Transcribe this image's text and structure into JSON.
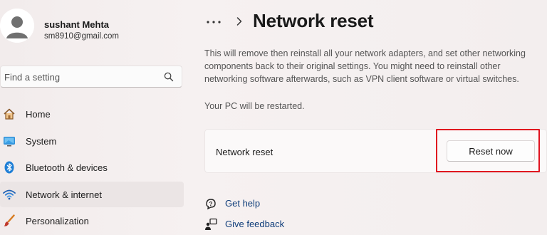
{
  "user": {
    "name": "sushant Mehta",
    "email": "sm8910@gmail.com"
  },
  "search": {
    "placeholder": "Find a setting"
  },
  "nav": {
    "items": [
      {
        "label": "Home",
        "icon": "home-icon"
      },
      {
        "label": "System",
        "icon": "system-icon"
      },
      {
        "label": "Bluetooth & devices",
        "icon": "bluetooth-icon"
      },
      {
        "label": "Network & internet",
        "icon": "wifi-icon",
        "active": true
      },
      {
        "label": "Personalization",
        "icon": "brush-icon"
      }
    ]
  },
  "header": {
    "more": "•••",
    "title": "Network reset"
  },
  "main": {
    "description": "This will remove then reinstall all your network adapters, and set other networking components back to their original settings. You might need to reinstall other networking software afterwards, such as VPN client software or virtual switches.",
    "restart_note": "Your PC will be restarted.",
    "card": {
      "label": "Network reset",
      "button": "Reset now"
    },
    "links": [
      {
        "label": "Get help",
        "icon": "help-icon"
      },
      {
        "label": "Give feedback",
        "icon": "feedback-icon"
      }
    ]
  },
  "colors": {
    "highlight": "#e0121f",
    "accent": "#0067c0",
    "link": "#0f3d7a"
  }
}
